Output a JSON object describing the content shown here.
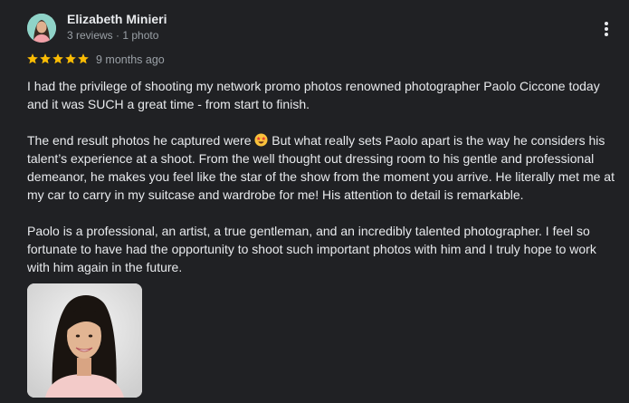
{
  "reviewer": {
    "name": "Elizabeth Minieri",
    "meta": "3 reviews · 1 photo"
  },
  "rating": {
    "stars": 5,
    "max": 5,
    "color": "#fbbc04"
  },
  "date": "9 months ago",
  "review": {
    "paragraph1": "I had the privilege of shooting my network promo photos renowned photographer Paolo Ciccone today and it was SUCH a great time - from start to finish.",
    "paragraph2_before_emoji": "The end result photos he captured were ",
    "emoji_name": "star-struck-emoji",
    "paragraph2_after_emoji": " But what really sets Paolo apart is the way he considers his talent’s experience at a shoot. From the well thought out dressing room to his gentle and professional demeanor, he makes you feel like the star of the show from the moment you arrive. He literally met me at my car to carry in my suitcase and wardrobe for me! His attention to detail is remarkable.",
    "paragraph3": "Paolo is a professional, an artist, a true gentleman, and an incredibly talented photographer. I feel so fortunate to have had the opportunity to shoot such important photos with him and I truly hope to work with him again in the future."
  },
  "icons": {
    "more": "more-vert-icon",
    "star": "star-icon"
  }
}
